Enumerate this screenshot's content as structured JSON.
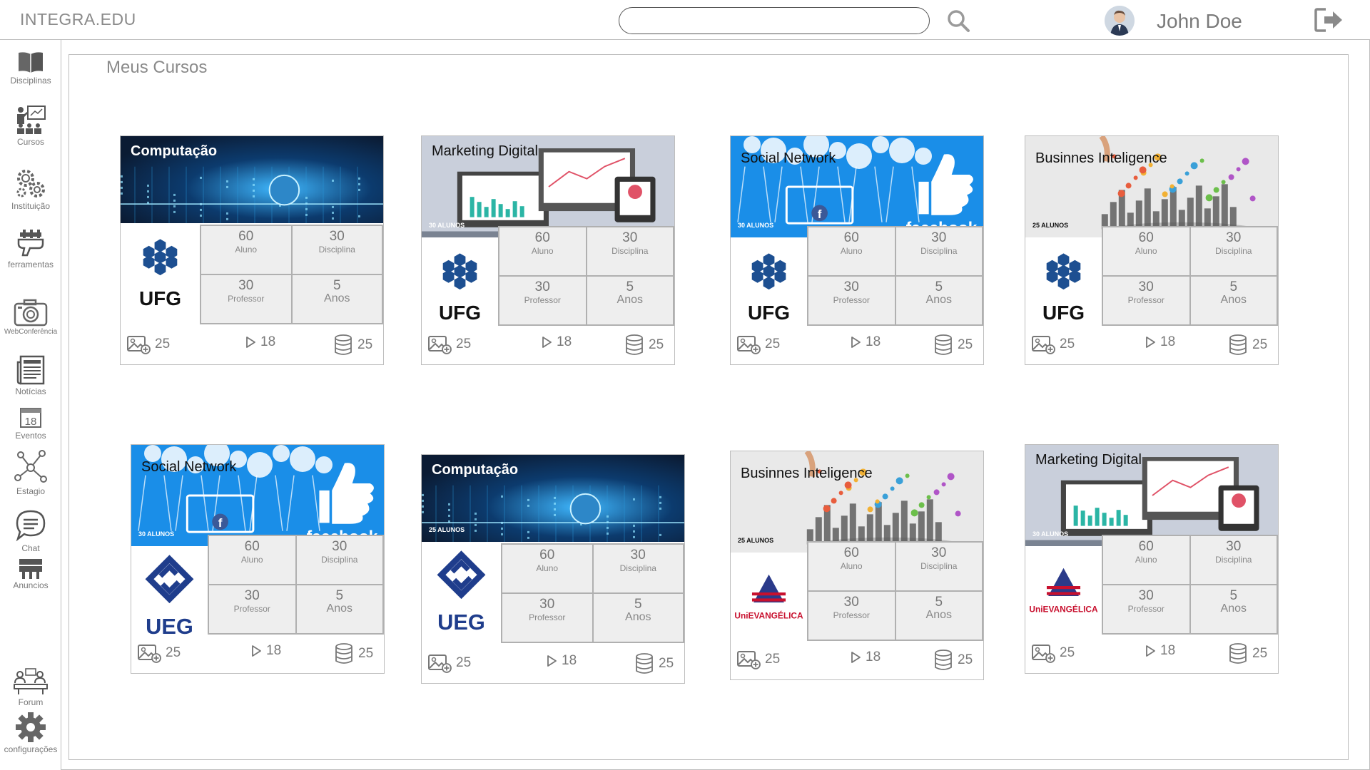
{
  "header": {
    "brand": "INTEGRA.EDU",
    "search": {
      "value": "",
      "placeholder": ""
    },
    "user_name": "John Doe"
  },
  "sidebar": {
    "items": [
      {
        "label": "Disciplinas",
        "icon": "book-icon"
      },
      {
        "label": "Cursos",
        "icon": "presentation-icon"
      },
      {
        "label": "Instituição",
        "icon": "gears-icon"
      },
      {
        "label": "ferramentas",
        "icon": "hand-tools-icon"
      },
      {
        "label": "WebConferência",
        "icon": "camera-icon"
      },
      {
        "label": "Notícias",
        "icon": "newspaper-icon"
      },
      {
        "label": "Eventos",
        "icon": "calendar-icon",
        "day": "18"
      },
      {
        "label": "Estagio",
        "icon": "network-icon"
      },
      {
        "label": "Chat",
        "icon": "chat-icon"
      },
      {
        "label": "Anuncios",
        "icon": "billboard-icon"
      },
      {
        "label": "Forum",
        "icon": "forum-icon"
      },
      {
        "label": "configurações",
        "icon": "gear-icon"
      }
    ]
  },
  "main": {
    "title": "Meus Cursos",
    "courses": [
      {
        "title": "Computação",
        "students": "",
        "logo": "UFG",
        "stats": {
          "aluno": "60",
          "aluno_label": "Aluno",
          "disciplina": "30",
          "disciplina_label": "Disciplina",
          "professor": "30",
          "professor_label": "Professor",
          "anos": "5",
          "anos_label": "Anos"
        },
        "footer": {
          "images": "25",
          "videos": "18",
          "files": "25"
        }
      },
      {
        "title": "Marketing Digital",
        "students": "30 ALUNOS",
        "logo": "UFG",
        "stats": {
          "aluno": "60",
          "aluno_label": "Aluno",
          "disciplina": "30",
          "disciplina_label": "Disciplina",
          "professor": "30",
          "professor_label": "Professor",
          "anos": "5",
          "anos_label": "Anos"
        },
        "footer": {
          "images": "25",
          "videos": "18",
          "files": "25"
        }
      },
      {
        "title": "Social Network",
        "students": "30 ALUNOS",
        "logo": "UFG",
        "banner_text": "facebook",
        "stats": {
          "aluno": "60",
          "aluno_label": "Aluno",
          "disciplina": "30",
          "disciplina_label": "Disciplina",
          "professor": "30",
          "professor_label": "Professor",
          "anos": "5",
          "anos_label": "Anos"
        },
        "footer": {
          "images": "25",
          "videos": "18",
          "files": "25"
        }
      },
      {
        "title": "Businnes Inteligence",
        "students": "25 ALUNOS",
        "logo": "UFG",
        "stats": {
          "aluno": "60",
          "aluno_label": "Aluno",
          "disciplina": "30",
          "disciplina_label": "Disciplina",
          "professor": "30",
          "professor_label": "Professor",
          "anos": "5",
          "anos_label": "Anos"
        },
        "footer": {
          "images": "25",
          "videos": "18",
          "files": "25"
        }
      },
      {
        "title": "Social Network",
        "students": "30 ALUNOS",
        "logo": "UEG",
        "banner_text": "facebook",
        "stats": {
          "aluno": "60",
          "aluno_label": "Aluno",
          "disciplina": "30",
          "disciplina_label": "Disciplina",
          "professor": "30",
          "professor_label": "Professor",
          "anos": "5",
          "anos_label": "Anos"
        },
        "footer": {
          "images": "25",
          "videos": "18",
          "files": "25"
        }
      },
      {
        "title": "Computação",
        "students": "25 ALUNOS",
        "logo": "UEG",
        "stats": {
          "aluno": "60",
          "aluno_label": "Aluno",
          "disciplina": "30",
          "disciplina_label": "Disciplina",
          "professor": "30",
          "professor_label": "Professor",
          "anos": "5",
          "anos_label": "Anos"
        },
        "footer": {
          "images": "25",
          "videos": "18",
          "files": "25"
        }
      },
      {
        "title": "Businnes Inteligence",
        "students": "25 ALUNOS",
        "logo": "UniEVANGÉLICA",
        "stats": {
          "aluno": "60",
          "aluno_label": "Aluno",
          "disciplina": "30",
          "disciplina_label": "Disciplina",
          "professor": "30",
          "professor_label": "Professor",
          "anos": "5",
          "anos_label": "Anos"
        },
        "footer": {
          "images": "25",
          "videos": "18",
          "files": "25"
        }
      },
      {
        "title": "Marketing Digital",
        "students": "30 ALUNOS",
        "logo": "UniEVANGÉLICA",
        "stats": {
          "aluno": "60",
          "aluno_label": "Aluno",
          "disciplina": "30",
          "disciplina_label": "Disciplina",
          "professor": "30",
          "professor_label": "Professor",
          "anos": "5",
          "anos_label": "Anos"
        },
        "footer": {
          "images": "25",
          "videos": "18",
          "files": "25"
        }
      }
    ]
  },
  "colors": {
    "ufg_blue": "#1d4f91",
    "ueg_blue": "#1f3d8c",
    "unievangelica_red": "#c8102e",
    "facebook_blue": "#1a8ee8",
    "computacao_dark": "#0b1b33",
    "border_gray": "#bdbdbd"
  }
}
